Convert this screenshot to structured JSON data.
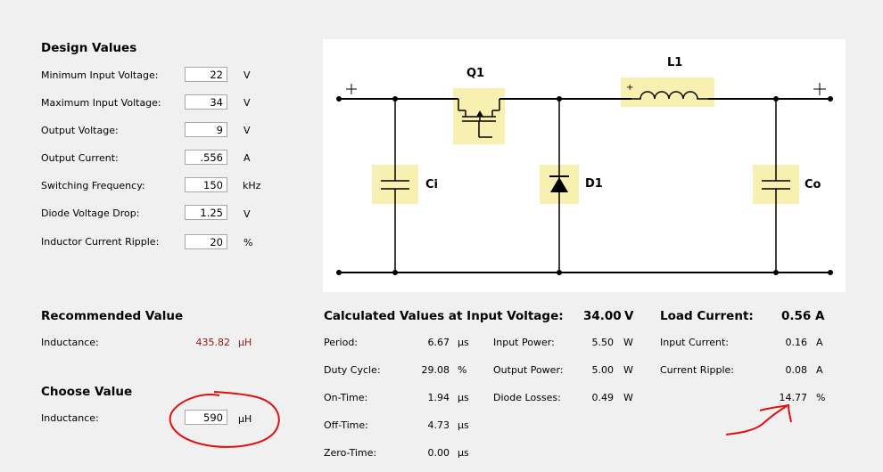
{
  "design": {
    "title": "Design Values",
    "rows": [
      {
        "label": "Minimum Input Voltage:",
        "value": "22",
        "unit": "V"
      },
      {
        "label": "Maximum Input Voltage:",
        "value": "34",
        "unit": "V"
      },
      {
        "label": "Output Voltage:",
        "value": "9",
        "unit": "V"
      },
      {
        "label": "Output Current:",
        "value": ".556",
        "unit": "A"
      },
      {
        "label": "Switching Frequency:",
        "value": "150",
        "unit": "kHz"
      },
      {
        "label": "Diode Voltage Drop:",
        "value": "1.25",
        "unit": "V"
      },
      {
        "label": "Inductor Current Ripple:",
        "value": "20",
        "unit": "%"
      }
    ]
  },
  "schematic": {
    "q1": "Q1",
    "l1": "L1",
    "ci": "Ci",
    "d1": "D1",
    "co": "Co",
    "plus": "+"
  },
  "recommended": {
    "title": "Recommended Value",
    "label": "Inductance:",
    "value": "435.82",
    "unit": "µH"
  },
  "choose": {
    "title": "Choose Value",
    "label": "Inductance:",
    "value": "590",
    "unit": "µH"
  },
  "calc": {
    "title": "Calculated Values at Input Voltage:",
    "voltage": "34.00",
    "voltage_unit": "V",
    "load_title": "Load Current:",
    "load_value": "0.56",
    "load_unit": "A",
    "col1": [
      {
        "label": "Period:",
        "value": "6.67",
        "unit": "µs"
      },
      {
        "label": "Duty Cycle:",
        "value": "29.08",
        "unit": "%"
      },
      {
        "label": "On-Time:",
        "value": "1.94",
        "unit": "µs"
      },
      {
        "label": "Off-Time:",
        "value": "4.73",
        "unit": "µs"
      },
      {
        "label": "Zero-Time:",
        "value": "0.00",
        "unit": "µs"
      }
    ],
    "col2": [
      {
        "label": "Input Power:",
        "value": "5.50",
        "unit": "W"
      },
      {
        "label": "Output Power:",
        "value": "5.00",
        "unit": "W"
      },
      {
        "label": "Diode Losses:",
        "value": "0.49",
        "unit": "W"
      }
    ],
    "col3": [
      {
        "label": "Input Current:",
        "value": "0.16",
        "unit": "A"
      },
      {
        "label": "Current Ripple:",
        "value": "0.08",
        "unit": "A"
      },
      {
        "label": "",
        "value": "14.77",
        "unit": "%"
      }
    ]
  },
  "colors": {
    "highlight": "#f8f0b0",
    "annotation": "#e01010",
    "recommended": "#8b1a1a"
  }
}
